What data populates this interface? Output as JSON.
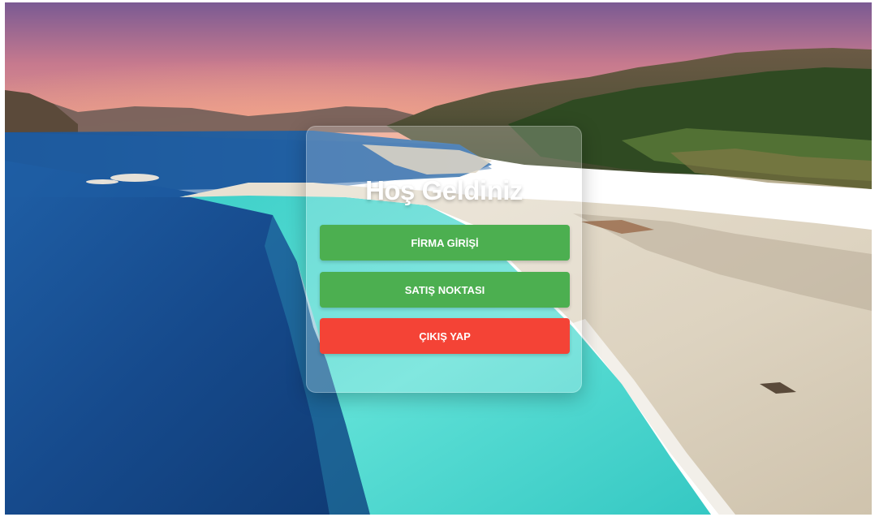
{
  "panel": {
    "title": "Hoş Geldiniz",
    "buttons": {
      "firma": {
        "label": "FİRMA GİRİŞİ",
        "color": "#4caf50"
      },
      "satis": {
        "label": "SATIŞ NOKTASI",
        "color": "#4caf50"
      },
      "cikis": {
        "label": "ÇIKIŞ YAP",
        "color": "#f44336"
      }
    }
  },
  "background": {
    "scene": "lake-with-white-beach-and-hills"
  }
}
